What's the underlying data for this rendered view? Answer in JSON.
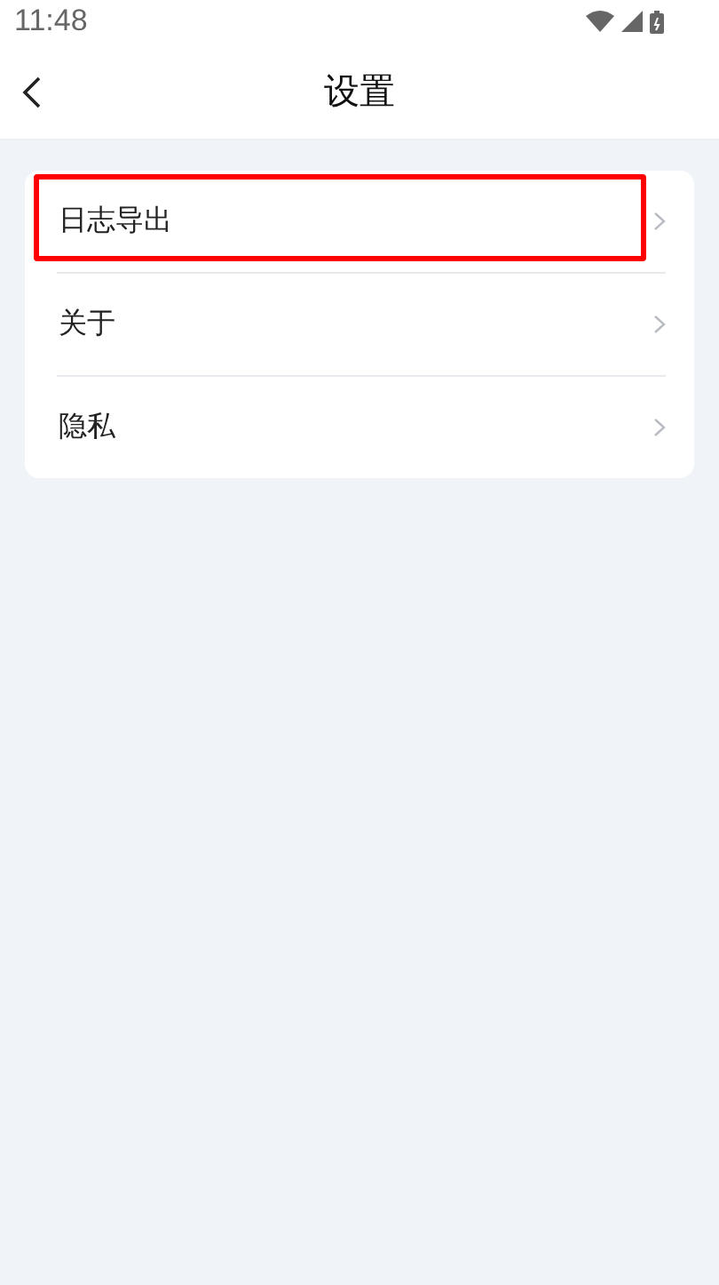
{
  "status_bar": {
    "time": "11:48"
  },
  "nav_bar": {
    "title": "设置"
  },
  "settings": [
    {
      "label": "日志导出",
      "highlighted": true
    },
    {
      "label": "关于",
      "highlighted": false
    },
    {
      "label": "隐私",
      "highlighted": false
    }
  ]
}
